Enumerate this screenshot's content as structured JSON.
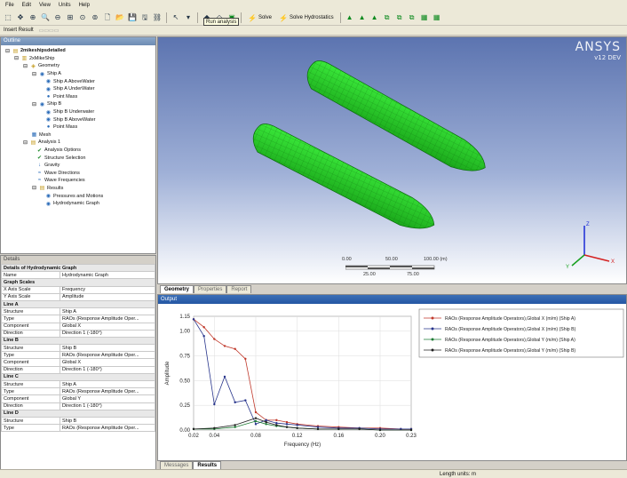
{
  "menu": [
    "File",
    "Edit",
    "View",
    "Units",
    "Help"
  ],
  "toolbar": {
    "solve_label": "Solve",
    "solve_hydrostatics_label": "Solve Hydrostatics",
    "tooltip": "Run analysis"
  },
  "insert_bar": {
    "insert_result": "Insert Result"
  },
  "outline": {
    "title": "Outline",
    "items": [
      "2mikeshipsdetailed",
      "2xMikeShip",
      "Geometry",
      "Ship A",
      "Ship A AboveWater",
      "Ship A UnderWater",
      "Point Mass",
      "Ship B",
      "Ship B Underwater",
      "Ship B AboveWater",
      "Point Mass",
      "Mesh",
      "Analysis 1",
      "Analysis Options",
      "Structure Selection",
      "Gravity",
      "Wave Directions",
      "Wave Frequencies",
      "Results",
      "Pressures and Motions",
      "Hydrodynamic Graph"
    ]
  },
  "details": {
    "title": "Details",
    "heading": "Details of Hydrodynamic Graph",
    "rows": [
      {
        "k": "Name",
        "v": "Hydrodynamic Graph",
        "hdr": false
      },
      {
        "k": "Graph Scales",
        "v": "",
        "hdr": true
      },
      {
        "k": "X Axis Scale",
        "v": "Frequency",
        "hdr": false
      },
      {
        "k": "Y Axis Scale",
        "v": "Amplitude",
        "hdr": false
      },
      {
        "k": "Line A",
        "v": "",
        "hdr": true
      },
      {
        "k": "Structure",
        "v": "Ship A",
        "hdr": false
      },
      {
        "k": "Type",
        "v": "RAOs (Response Amplitude Oper...",
        "hdr": false
      },
      {
        "k": "Component",
        "v": "Global X",
        "hdr": false
      },
      {
        "k": "Direction",
        "v": "Direction 1 (-180°)",
        "hdr": false
      },
      {
        "k": "Line B",
        "v": "",
        "hdr": true
      },
      {
        "k": "Structure",
        "v": "Ship B",
        "hdr": false
      },
      {
        "k": "Type",
        "v": "RAOs (Response Amplitude Oper...",
        "hdr": false
      },
      {
        "k": "Component",
        "v": "Global X",
        "hdr": false
      },
      {
        "k": "Direction",
        "v": "Direction 1 (-180°)",
        "hdr": false
      },
      {
        "k": "Line C",
        "v": "",
        "hdr": true
      },
      {
        "k": "Structure",
        "v": "Ship A",
        "hdr": false
      },
      {
        "k": "Type",
        "v": "RAOs (Response Amplitude Oper...",
        "hdr": false
      },
      {
        "k": "Component",
        "v": "Global Y",
        "hdr": false
      },
      {
        "k": "Direction",
        "v": "Direction 1 (-180°)",
        "hdr": false
      },
      {
        "k": "Line D",
        "v": "",
        "hdr": true
      },
      {
        "k": "Structure",
        "v": "Ship B",
        "hdr": false
      },
      {
        "k": "Type",
        "v": "RAOs (Response Amplitude Oper...",
        "hdr": false
      }
    ]
  },
  "viewport": {
    "logo": "ANSYS",
    "version": "v12 DEV",
    "scale_top": [
      "0.00",
      "50.00",
      "100.00 (m)"
    ],
    "scale_bottom": [
      "25.00",
      "75.00"
    ]
  },
  "viewport_tabs": [
    "Geometry",
    "Properties",
    "Report"
  ],
  "output": {
    "title": "Output"
  },
  "output_tabs": [
    "Messages",
    "Results"
  ],
  "status": {
    "length_units": "Length units: m"
  },
  "colors": {
    "ship": "#2ed62e",
    "titlebar": "#2456a3"
  },
  "chart_data": {
    "type": "line",
    "xlabel": "Frequency (Hz)",
    "ylabel": "Amplitude",
    "xlim": [
      0.02,
      0.23
    ],
    "ylim": [
      0.0,
      1.15
    ],
    "xticks": [
      "0.02",
      "0.04",
      "0.08",
      "0.12",
      "0.16",
      "0.20",
      "0.23"
    ],
    "xtick_values": [
      0.02,
      0.04,
      0.08,
      0.12,
      0.16,
      0.2,
      0.23
    ],
    "yticks": [
      "1.15",
      "1.00",
      "0.75",
      "0.50",
      "0.25",
      "0.00"
    ],
    "ytick_values": [
      1.15,
      1.0,
      0.75,
      0.5,
      0.25,
      0.0
    ],
    "grid": true,
    "legend_position": "top-right",
    "series": [
      {
        "name": "RAOs (Response Amplitude Operators),Global X (m/m) (Ship A)",
        "color": "#c0392b",
        "x": [
          0.02,
          0.03,
          0.04,
          0.05,
          0.06,
          0.07,
          0.08,
          0.09,
          0.1,
          0.11,
          0.12,
          0.14,
          0.16,
          0.18,
          0.2,
          0.22,
          0.23
        ],
        "y": [
          1.12,
          1.04,
          0.92,
          0.85,
          0.82,
          0.72,
          0.18,
          0.1,
          0.1,
          0.08,
          0.06,
          0.04,
          0.03,
          0.02,
          0.02,
          0.01,
          0.01
        ]
      },
      {
        "name": "RAOs (Response Amplitude Operators),Global X (m/m) (Ship B)",
        "color": "#27348b",
        "x": [
          0.02,
          0.03,
          0.04,
          0.05,
          0.06,
          0.07,
          0.08,
          0.09,
          0.1,
          0.11,
          0.12,
          0.14,
          0.16,
          0.18,
          0.2,
          0.22,
          0.23
        ],
        "y": [
          1.12,
          0.95,
          0.26,
          0.54,
          0.28,
          0.3,
          0.06,
          0.1,
          0.07,
          0.06,
          0.05,
          0.03,
          0.02,
          0.02,
          0.01,
          0.01,
          0.01
        ]
      },
      {
        "name": "RAOs (Response Amplitude Operators),Global Y (m/m) (Ship A)",
        "color": "#1e7b34",
        "x": [
          0.02,
          0.04,
          0.06,
          0.08,
          0.09,
          0.1,
          0.11,
          0.12,
          0.14,
          0.16,
          0.18,
          0.2,
          0.23
        ],
        "y": [
          0.01,
          0.01,
          0.03,
          0.09,
          0.06,
          0.04,
          0.03,
          0.02,
          0.01,
          0.01,
          0.01,
          0.0,
          0.0
        ]
      },
      {
        "name": "RAOs (Response Amplitude Operators),Global Y (m/m) (Ship B)",
        "color": "#202020",
        "x": [
          0.02,
          0.04,
          0.06,
          0.08,
          0.09,
          0.1,
          0.11,
          0.12,
          0.14,
          0.16,
          0.18,
          0.2,
          0.23
        ],
        "y": [
          0.01,
          0.02,
          0.05,
          0.12,
          0.08,
          0.05,
          0.03,
          0.02,
          0.01,
          0.01,
          0.01,
          0.0,
          0.0
        ]
      }
    ]
  }
}
